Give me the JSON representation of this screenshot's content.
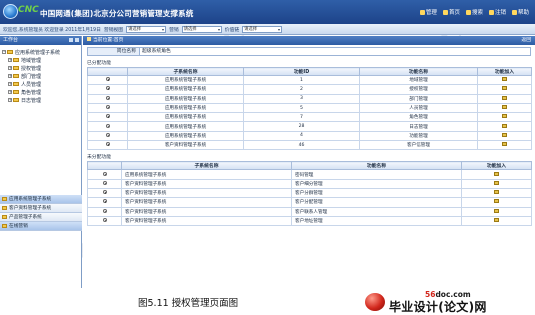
{
  "app": {
    "logo_text": "CNC",
    "title": "中国网通(集团)北京分公司营销管理支撑系统",
    "top_links": [
      "管理",
      "首页",
      "搜索",
      "注销",
      "帮助"
    ]
  },
  "infobar": {
    "welcome": "欢迎您,系统管理员 欢迎登录 2011年1月19日",
    "fields": [
      {
        "label": "营销视图",
        "value": "请选择"
      },
      {
        "label": "营销",
        "value": "请选择"
      },
      {
        "label": "价值链",
        "value": "请选择"
      }
    ]
  },
  "left": {
    "panel_title": "工作台",
    "tree": [
      {
        "label": "应用系统管理子系统",
        "child": false
      },
      {
        "label": "地域管理",
        "child": true
      },
      {
        "label": "授权管理",
        "child": true
      },
      {
        "label": "部门管理",
        "child": true
      },
      {
        "label": "人员管理",
        "child": true
      },
      {
        "label": "角色管理",
        "child": true
      },
      {
        "label": "日志管理",
        "child": true
      }
    ],
    "nav": [
      {
        "label": "应用系统管理子系统",
        "active": true
      },
      {
        "label": "客户资料管理子系统",
        "active": false
      },
      {
        "label": "产品管理子系统",
        "active": false
      },
      {
        "label": "在线营销",
        "active": true
      }
    ]
  },
  "main": {
    "breadcrumb": "当前位置:首页",
    "back_label": "返回",
    "role_label": "岗位名称",
    "role_value": "超级系统角色",
    "assigned_label": "已分配功能",
    "unassigned_label": "未分配功能",
    "assigned_headers": [
      "",
      "子系统名称",
      "功能ID",
      "功能名称",
      "功能加入"
    ],
    "assigned_rows": [
      {
        "sub": "应用系统管理子系统",
        "id": "1",
        "name": "地域管理"
      },
      {
        "sub": "应用系统管理子系统",
        "id": "2",
        "name": "授权管理"
      },
      {
        "sub": "应用系统管理子系统",
        "id": "3",
        "name": "部门管理"
      },
      {
        "sub": "应用系统管理子系统",
        "id": "5",
        "name": "人员管理"
      },
      {
        "sub": "应用系统管理子系统",
        "id": "7",
        "name": "角色管理"
      },
      {
        "sub": "应用系统管理子系统",
        "id": "28",
        "name": "日志管理"
      },
      {
        "sub": "应用系统管理子系统",
        "id": "4",
        "name": "功能管理"
      },
      {
        "sub": "客户资料管理子系统",
        "id": "46",
        "name": "客户信管理"
      }
    ],
    "unassigned_headers": [
      "",
      "子系统名称",
      "功能名称",
      "功能加入"
    ],
    "unassigned_rows": [
      {
        "sub": "应用系统管理子系统",
        "name": "密码管理"
      },
      {
        "sub": "客户资料管理子系统",
        "name": "客户细分管理"
      },
      {
        "sub": "客户资料管理子系统",
        "name": "客户分群管理"
      },
      {
        "sub": "客户资料管理子系统",
        "name": "客户分配管理"
      },
      {
        "sub": "客户资料管理子系统",
        "name": "客户联系人管理"
      },
      {
        "sub": "客户资料管理子系统",
        "name": "客户地址管理"
      }
    ]
  },
  "caption": "图5.11  授权管理页面图",
  "brand": {
    "site_prefix": "56",
    "site_rest": "doc.com",
    "name": "毕业设计(论文)网"
  },
  "watermark": "56DOC.COM"
}
